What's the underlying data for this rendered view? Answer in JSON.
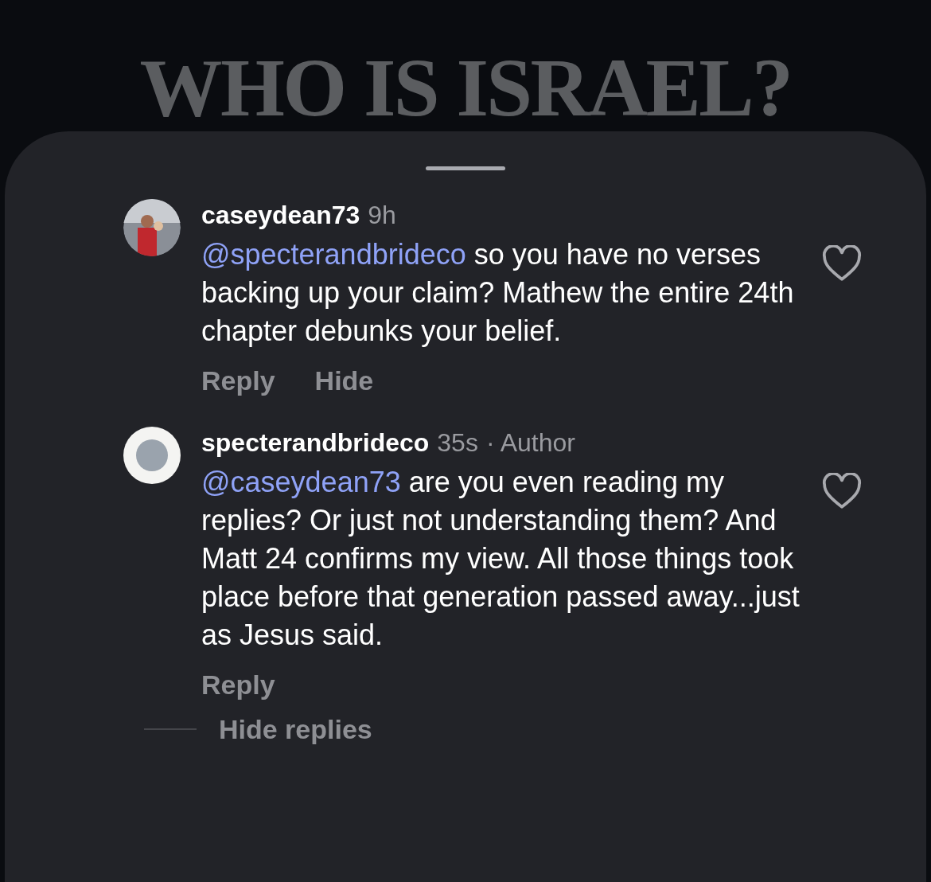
{
  "post": {
    "title": "WHO IS ISRAEL?"
  },
  "comments": [
    {
      "username": "caseydean73",
      "time": "9h",
      "mention": "@specterandbrideco",
      "text": "so you have no verses backing up your claim? Mathew the entire 24th chapter debunks your belief.",
      "liked": false,
      "actions": [
        "Reply",
        "Hide"
      ]
    },
    {
      "username": "specterandbrideco",
      "time": "35s",
      "author_label": "· Author",
      "mention": "@caseydean73",
      "text": "are you even reading my replies? Or just not understanding them? And Matt 24 confirms my view. All those things took place before that generation passed away...just as Jesus said.",
      "liked": false,
      "actions": [
        "Reply"
      ]
    }
  ],
  "hide_replies": "Hide replies"
}
